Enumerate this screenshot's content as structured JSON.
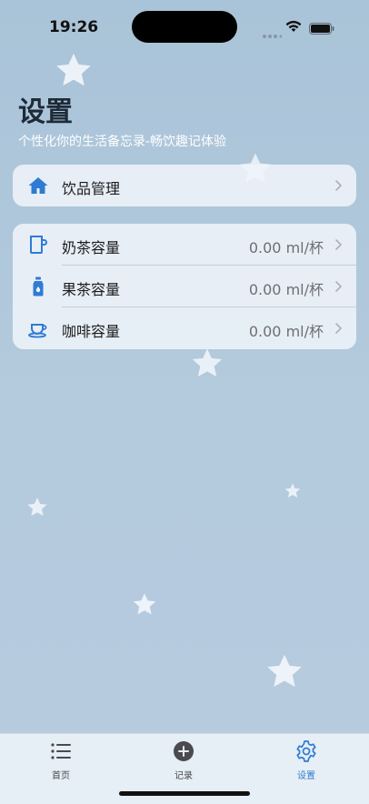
{
  "status_bar": {
    "time": "19:26",
    "icons": [
      "signal-icon",
      "wifi-icon",
      "battery-icon"
    ]
  },
  "page": {
    "title": "设置",
    "subtitle": "个性化你的生活备忘录-畅饮趣记体验"
  },
  "sections": {
    "management": [
      {
        "label": "饮品管理",
        "icon": "house-icon"
      }
    ],
    "capacity": [
      {
        "label": "奶茶容量",
        "value": "0.00 ml/杯",
        "icon": "mug-icon"
      },
      {
        "label": "果茶容量",
        "value": "0.00 ml/杯",
        "icon": "bottle-icon"
      },
      {
        "label": "咖啡容量",
        "value": "0.00 ml/杯",
        "icon": "coffee-cup-icon"
      }
    ]
  },
  "tabbar": {
    "tabs": [
      {
        "label": "首页",
        "icon": "list-icon",
        "active": false
      },
      {
        "label": "记录",
        "icon": "plus-circle-icon",
        "active": false
      },
      {
        "label": "设置",
        "icon": "gear-icon",
        "active": true
      }
    ]
  },
  "colors": {
    "accent": "#2f7bd4",
    "background": "#b0c8dc",
    "card": "#eef2f8"
  }
}
